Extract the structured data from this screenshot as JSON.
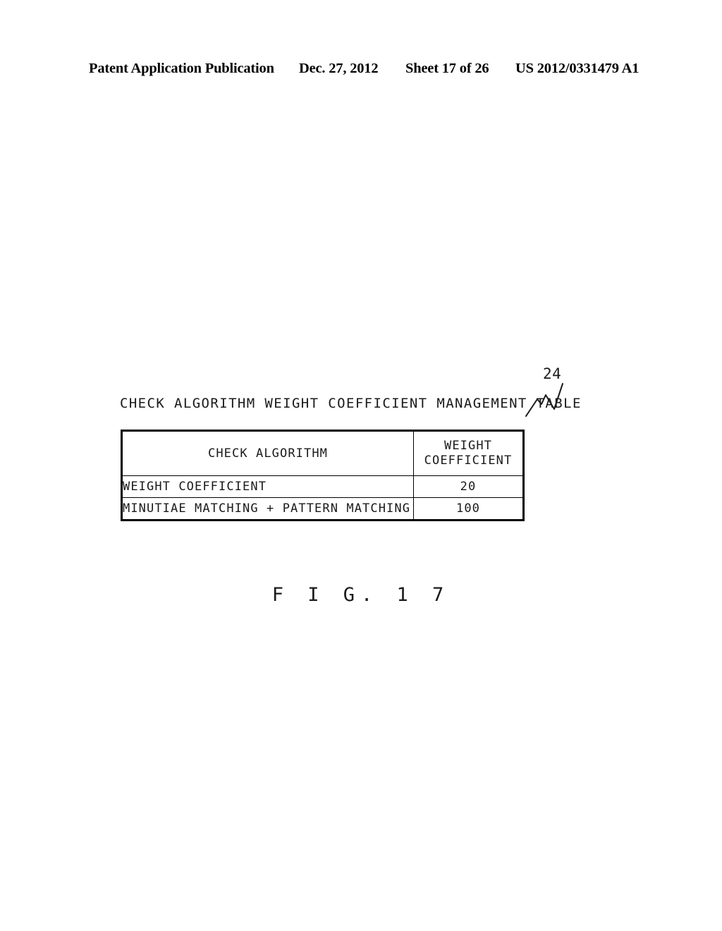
{
  "header": {
    "publication": "Patent Application Publication",
    "date": "Dec. 27, 2012",
    "sheet": "Sheet 17 of 26",
    "document_number": "US 2012/0331479 A1"
  },
  "figure": {
    "caption": "F I G.  1 7",
    "reference_numeral": "24",
    "title": "CHECK ALGORITHM WEIGHT COEFFICIENT MANAGEMENT TABLE",
    "leader_icon": "zigzag-leader-line-icon"
  },
  "table": {
    "columns": [
      {
        "label": "CHECK ALGORITHM"
      },
      {
        "label_line1": "WEIGHT",
        "label_line2": "COEFFICIENT"
      }
    ],
    "rows": [
      {
        "algorithm": "WEIGHT COEFFICIENT",
        "coefficient": "20"
      },
      {
        "algorithm": "MINUTIAE MATCHING + PATTERN MATCHING",
        "coefficient": "100"
      }
    ]
  },
  "colors": {
    "ink": "#1a1a1a",
    "rule": "#000000",
    "page": "#ffffff"
  }
}
